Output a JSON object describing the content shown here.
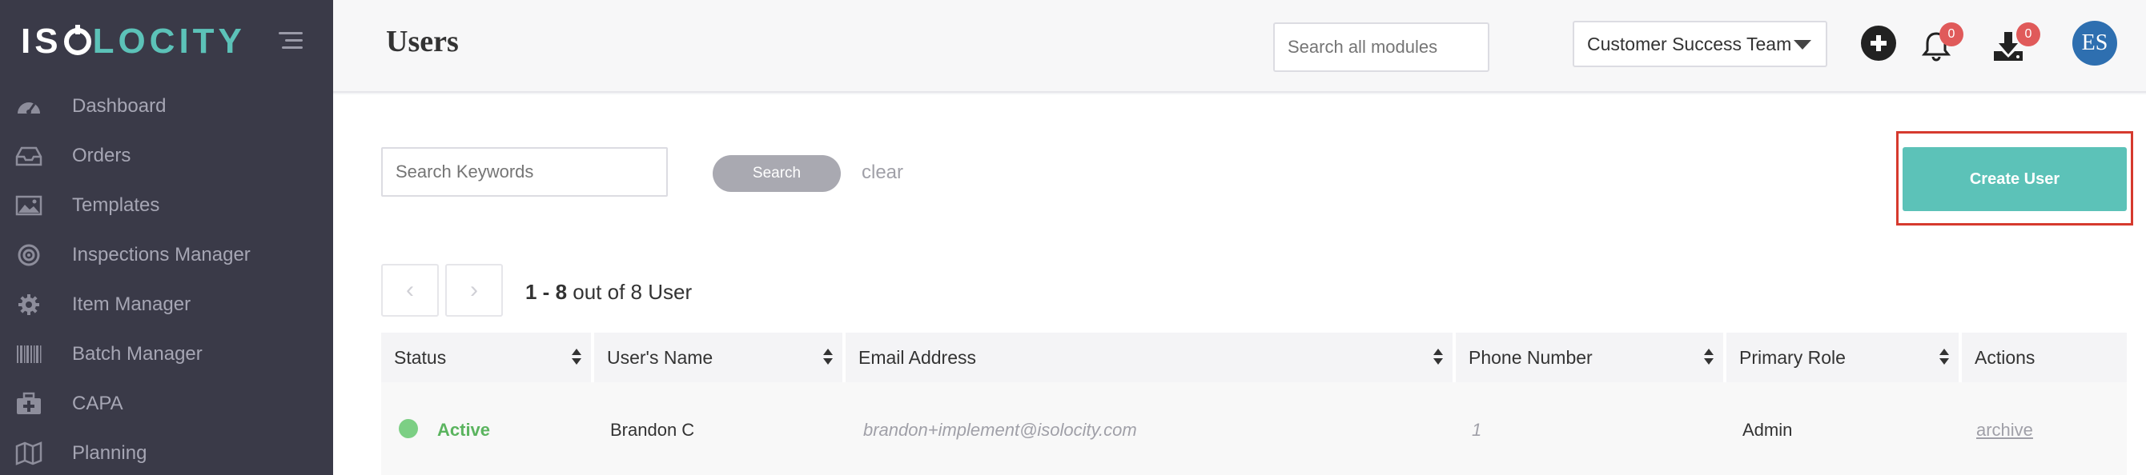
{
  "app": {
    "logo_left": "IS",
    "logo_right": "LOCITY"
  },
  "sidebar": {
    "items": [
      {
        "label": "Dashboard",
        "icon": "dashboard-gauge-icon"
      },
      {
        "label": "Orders",
        "icon": "inbox-tray-icon"
      },
      {
        "label": "Templates",
        "icon": "image-template-icon"
      },
      {
        "label": "Inspections Manager",
        "icon": "target-icon"
      },
      {
        "label": "Item Manager",
        "icon": "gear-icon"
      },
      {
        "label": "Batch Manager",
        "icon": "barcode-icon"
      },
      {
        "label": "CAPA",
        "icon": "medkit-icon"
      },
      {
        "label": "Planning",
        "icon": "map-icon"
      }
    ]
  },
  "header": {
    "title": "Users",
    "search_placeholder": "Search all modules",
    "team": "Customer Success Team",
    "notifications_count": "0",
    "downloads_count": "0",
    "avatar_initials": "ES"
  },
  "toolbar": {
    "keyword_placeholder": "Search Keywords",
    "search_label": "Search",
    "clear_label": "clear",
    "create_label": "Create User"
  },
  "pagination": {
    "range": "1 - 8",
    "suffix": "out of 8 User"
  },
  "table": {
    "columns": [
      "Status",
      "User's Name",
      "Email Address",
      "Phone Number",
      "Primary Role",
      "Actions"
    ],
    "rows": [
      {
        "status": "Active",
        "name": "Brandon C",
        "email": "brandon+implement@isolocity.com",
        "phone": "1",
        "role": "Admin",
        "action": "archive"
      }
    ]
  },
  "colors": {
    "sidebar_bg": "#3a3a48",
    "accent": "#5cc2b8",
    "badge": "#e05a5a",
    "avatar": "#2e6fb0",
    "active_status": "#5bb45f",
    "highlight_border": "#d63a2e"
  }
}
